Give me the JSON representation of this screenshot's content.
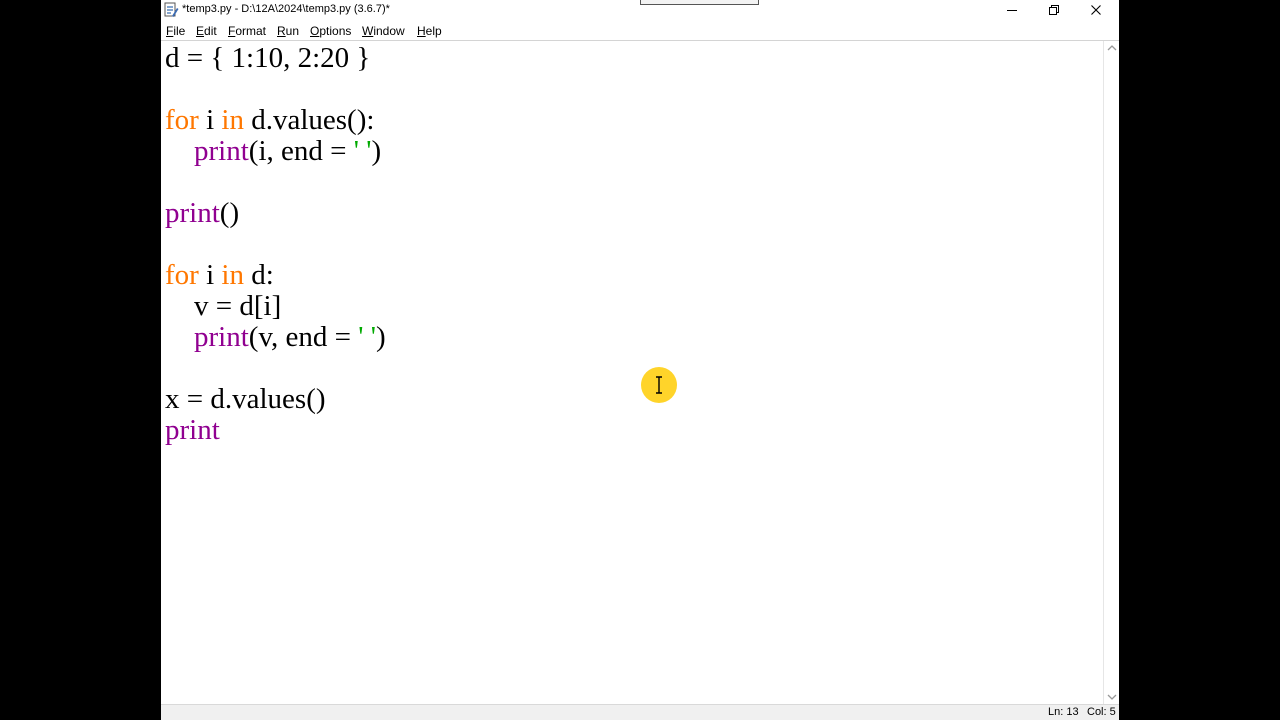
{
  "window": {
    "title": "*temp3.py - D:\\12A\\2024\\temp3.py (3.6.7)*"
  },
  "menu": {
    "items": [
      {
        "label": "File",
        "key": "F",
        "rest": "ile"
      },
      {
        "label": "Edit",
        "key": "E",
        "rest": "dit"
      },
      {
        "label": "Format",
        "key": "F",
        "rest": "ormat"
      },
      {
        "label": "Run",
        "key": "R",
        "rest": "un"
      },
      {
        "label": "Options",
        "key": "O",
        "rest": "ptions"
      },
      {
        "label": "Window",
        "key": "W",
        "rest": "indow"
      },
      {
        "label": "Help",
        "key": "H",
        "rest": "elp"
      }
    ]
  },
  "editor": {
    "lines": [
      {
        "indent": "",
        "tokens": [
          {
            "t": "d = { 1:10, 2:20 }",
            "c": ""
          }
        ]
      },
      {
        "indent": "",
        "tokens": []
      },
      {
        "indent": "",
        "tokens": [
          {
            "t": "for",
            "c": "kw"
          },
          {
            "t": " i ",
            "c": ""
          },
          {
            "t": "in",
            "c": "kw"
          },
          {
            "t": " d.values():",
            "c": ""
          }
        ]
      },
      {
        "indent": "    ",
        "tokens": [
          {
            "t": "print",
            "c": "bi"
          },
          {
            "t": "(i, end = ",
            "c": ""
          },
          {
            "t": "' '",
            "c": "str"
          },
          {
            "t": ")",
            "c": ""
          }
        ]
      },
      {
        "indent": "",
        "tokens": []
      },
      {
        "indent": "",
        "tokens": [
          {
            "t": "print",
            "c": "bi"
          },
          {
            "t": "()",
            "c": ""
          }
        ]
      },
      {
        "indent": "",
        "tokens": []
      },
      {
        "indent": "",
        "tokens": [
          {
            "t": "for",
            "c": "kw"
          },
          {
            "t": " i ",
            "c": ""
          },
          {
            "t": "in",
            "c": "kw"
          },
          {
            "t": " d:",
            "c": ""
          }
        ]
      },
      {
        "indent": "    ",
        "tokens": [
          {
            "t": "v = d[i]",
            "c": ""
          }
        ]
      },
      {
        "indent": "    ",
        "tokens": [
          {
            "t": "print",
            "c": "bi"
          },
          {
            "t": "(v, end = ",
            "c": ""
          },
          {
            "t": "' '",
            "c": "str"
          },
          {
            "t": ")",
            "c": ""
          }
        ]
      },
      {
        "indent": "",
        "tokens": []
      },
      {
        "indent": "",
        "tokens": [
          {
            "t": "x = d.values()",
            "c": ""
          }
        ]
      },
      {
        "indent": "",
        "tokens": [
          {
            "t": "print",
            "c": "bi"
          }
        ]
      }
    ]
  },
  "status": {
    "ln": "Ln: 13",
    "col": "Col: 5"
  },
  "colors": {
    "keyword": "#ff7700",
    "builtin": "#900090",
    "string": "#00aa00",
    "cursor_highlight": "#ffd21f"
  }
}
